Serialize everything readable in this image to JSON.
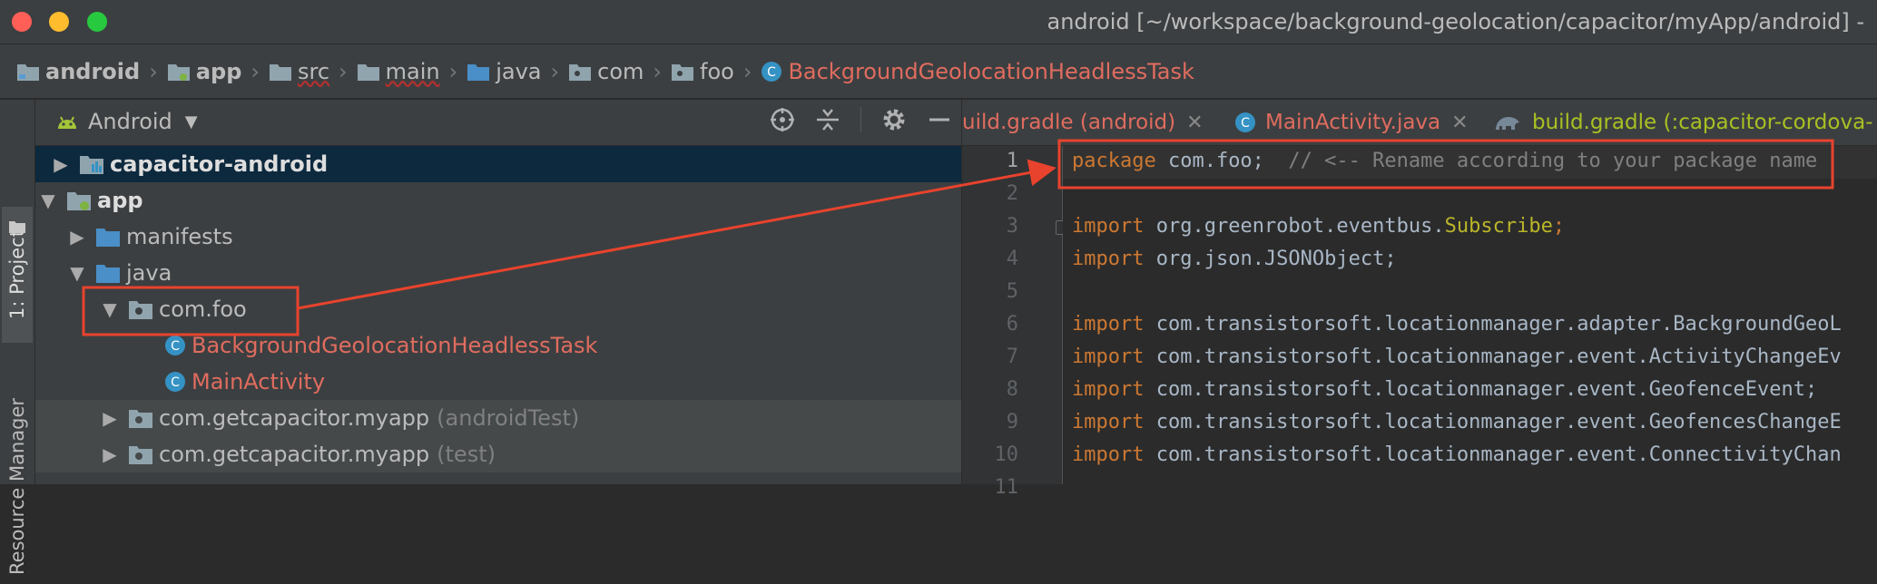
{
  "window": {
    "title": "android [~/workspace/background-geolocation/capacitor/myApp/android] -"
  },
  "breadcrumbs": [
    {
      "label": "android",
      "icon": "module-folder-icon"
    },
    {
      "label": "app",
      "icon": "module-folder-icon"
    },
    {
      "label": "src",
      "icon": "folder-icon"
    },
    {
      "label": "main",
      "icon": "folder-icon"
    },
    {
      "label": "java",
      "icon": "source-folder-icon"
    },
    {
      "label": "com",
      "icon": "package-icon"
    },
    {
      "label": "foo",
      "icon": "package-icon"
    },
    {
      "label": "BackgroundGeolocationHeadlessTask",
      "icon": "class-icon"
    }
  ],
  "side_tabs": {
    "project": "1: Project",
    "resource_manager": "Resource Manager"
  },
  "project_panel": {
    "view_label": "Android"
  },
  "tree": [
    {
      "label": "capacitor-android",
      "suffix": ""
    },
    {
      "label": "app",
      "suffix": ""
    },
    {
      "label": "manifests",
      "suffix": ""
    },
    {
      "label": "java",
      "suffix": ""
    },
    {
      "label": "com.foo",
      "suffix": ""
    },
    {
      "label": "BackgroundGeolocationHeadlessTask",
      "suffix": ""
    },
    {
      "label": "MainActivity",
      "suffix": ""
    },
    {
      "label": "com.getcapacitor.myapp",
      "suffix": "(androidTest)"
    },
    {
      "label": "com.getcapacitor.myapp",
      "suffix": "(test)"
    }
  ],
  "editor_tabs": [
    {
      "label": "uild.gradle (android)"
    },
    {
      "label": "MainActivity.java"
    },
    {
      "label": "build.gradle (:capacitor-cordova-"
    }
  ],
  "line_numbers": [
    "1",
    "2",
    "3",
    "4",
    "5",
    "6",
    "7",
    "8",
    "9",
    "10",
    "11"
  ],
  "code": {
    "l1_kw": "package",
    "l1_pkg": " com.foo;  ",
    "l1_comment": "// <-- Rename according to your package name",
    "l3_kw": "import",
    "l3_path": " org.greenrobot.eventbus.",
    "l3_ann": "Subscribe",
    "l3_end": ";",
    "l4_kw": "import",
    "l4_path": " org.json.JSONObject;",
    "l6_kw": "import",
    "l6_path": " com.transistorsoft.locationmanager.adapter.BackgroundGeoL",
    "l7_kw": "import",
    "l7_path": " com.transistorsoft.locationmanager.event.ActivityChangeEv",
    "l8_kw": "import",
    "l8_path": " com.transistorsoft.locationmanager.event.GeofenceEvent;",
    "l9_kw": "import",
    "l9_path": " com.transistorsoft.locationmanager.event.GeofencesChangeE",
    "l10_kw": "import",
    "l10_path": " com.transistorsoft.locationmanager.event.ConnectivityChan"
  },
  "colors": {
    "annotation": "#e8432d",
    "selection": "#0d293e",
    "red_file": "#e06c5f"
  }
}
